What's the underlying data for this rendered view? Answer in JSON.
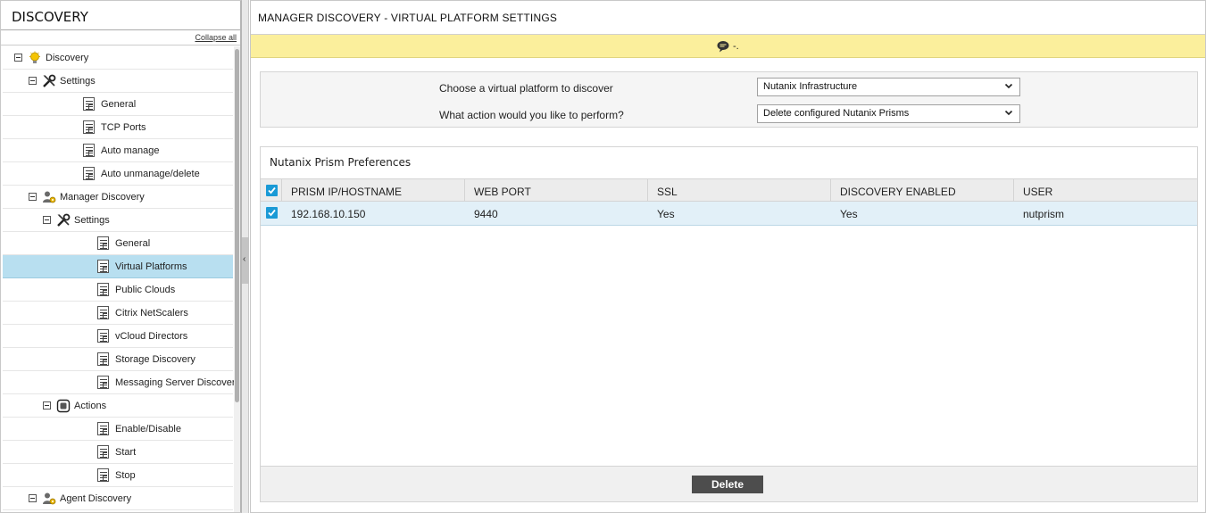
{
  "left_panel": {
    "title": "DISCOVERY",
    "collapse_all": "Collapse all",
    "tree": [
      {
        "label": "Discovery",
        "icon": "bulb-icon"
      },
      {
        "label": "Settings",
        "icon": "tools-icon"
      },
      {
        "label": "General",
        "icon": "document-icon"
      },
      {
        "label": "TCP Ports",
        "icon": "document-icon"
      },
      {
        "label": "Auto manage",
        "icon": "document-icon"
      },
      {
        "label": "Auto unmanage/delete",
        "icon": "document-icon"
      },
      {
        "label": "Manager Discovery",
        "icon": "user-gear-icon"
      },
      {
        "label": "Settings",
        "icon": "tools-icon"
      },
      {
        "label": "General",
        "icon": "document-icon"
      },
      {
        "label": "Virtual Platforms",
        "icon": "document-icon",
        "selected": true
      },
      {
        "label": "Public Clouds",
        "icon": "document-icon"
      },
      {
        "label": "Citrix NetScalers",
        "icon": "document-icon"
      },
      {
        "label": "vCloud Directors",
        "icon": "document-icon"
      },
      {
        "label": "Storage Discovery",
        "icon": "document-icon"
      },
      {
        "label": "Messaging Server Discovery",
        "icon": "document-icon"
      },
      {
        "label": "Actions",
        "icon": "action-icon"
      },
      {
        "label": "Enable/Disable",
        "icon": "document-icon"
      },
      {
        "label": "Start",
        "icon": "document-icon"
      },
      {
        "label": "Stop",
        "icon": "document-icon"
      },
      {
        "label": "Agent Discovery",
        "icon": "user-gear-icon"
      }
    ]
  },
  "main": {
    "title": "MANAGER DISCOVERY - VIRTUAL PLATFORM SETTINGS",
    "notice": "-.",
    "form": {
      "platform_label": "Choose a virtual platform to discover",
      "platform_value": "Nutanix Infrastructure",
      "action_label": "What action would you like to perform?",
      "action_value": "Delete configured Nutanix Prisms"
    },
    "prefs": {
      "title": "Nutanix Prism Preferences",
      "columns": [
        "PRISM IP/HOSTNAME",
        "WEB PORT",
        "SSL",
        "DISCOVERY ENABLED",
        "USER"
      ],
      "rows": [
        {
          "checked": true,
          "cells": [
            "192.168.10.150",
            "9440",
            "Yes",
            "Yes",
            "nutprism"
          ]
        }
      ]
    },
    "delete_label": "Delete"
  },
  "colors": {
    "selected_row": "#b8dff0",
    "notice_bg": "#fbef9c",
    "checkbox": "#1a9ad6",
    "button": "#4d4d4d"
  }
}
